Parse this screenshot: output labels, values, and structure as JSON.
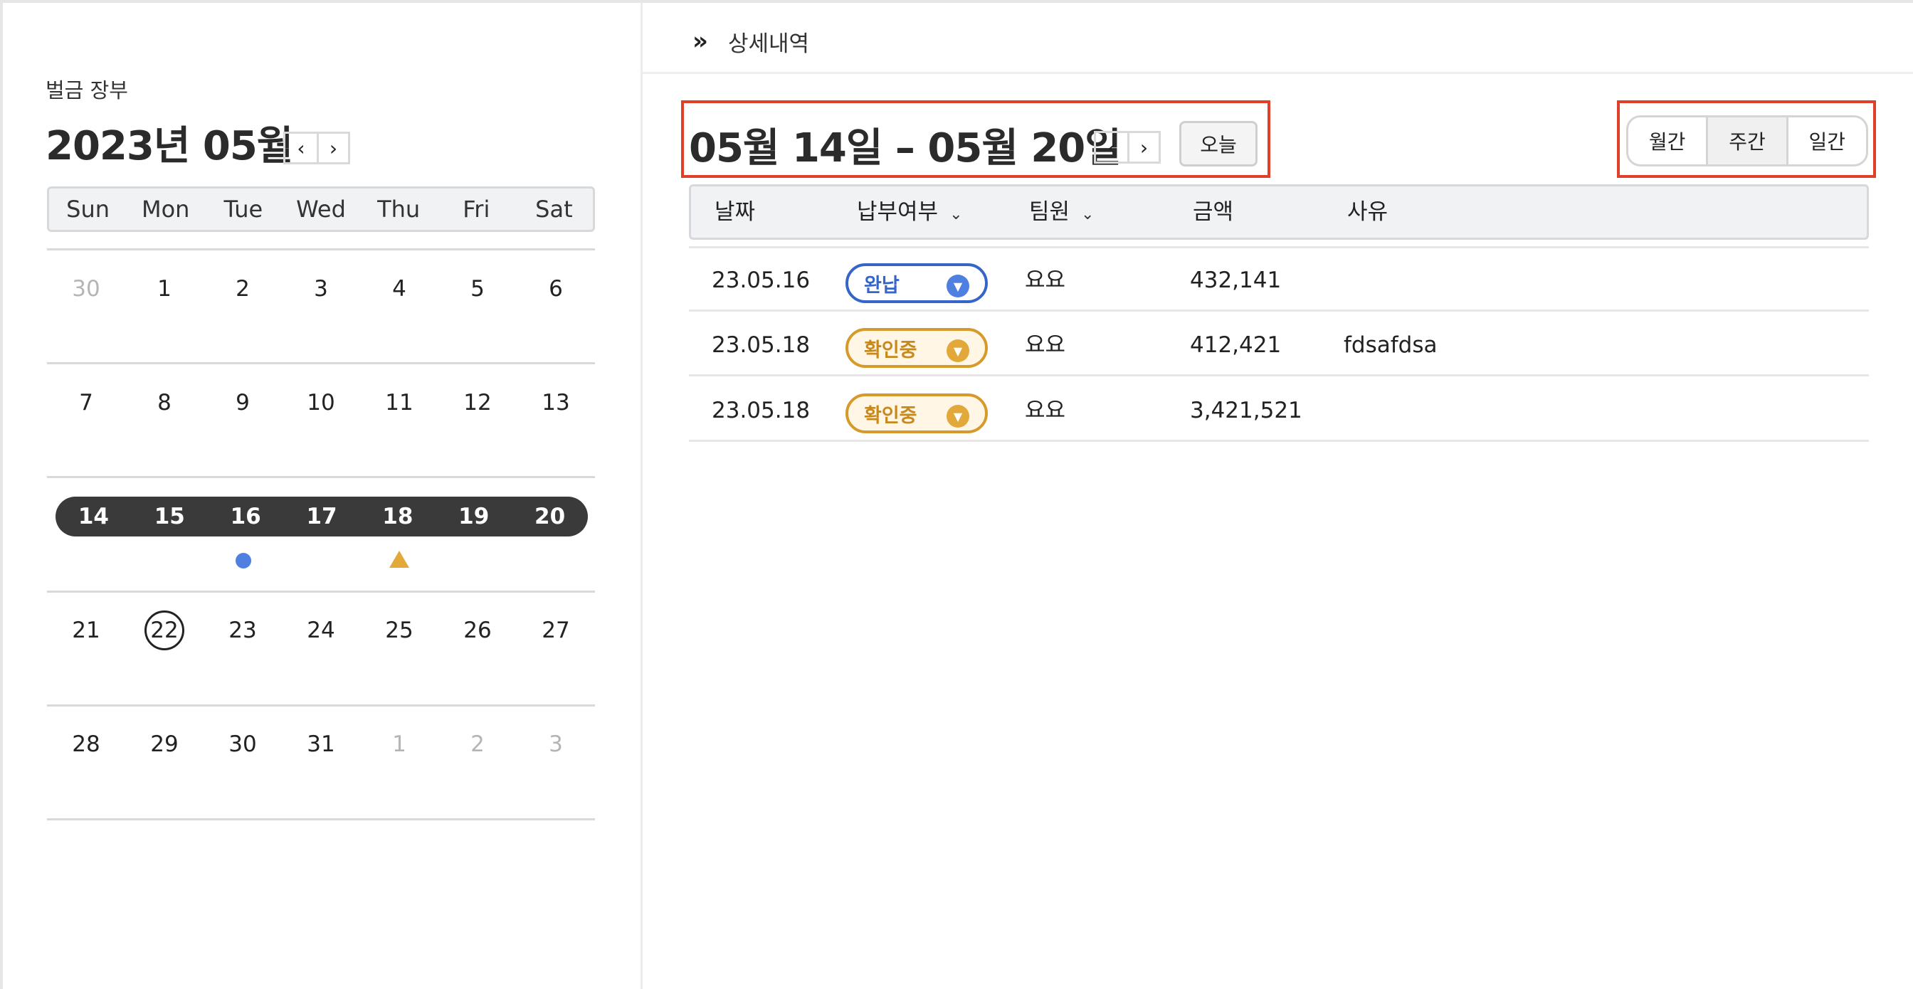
{
  "calendar": {
    "ledger_title": "벌금 장부",
    "month_title": "2023년 05월",
    "prev": "‹",
    "next": "›",
    "weekdays": [
      "Sun",
      "Mon",
      "Tue",
      "Wed",
      "Thu",
      "Fri",
      "Sat"
    ],
    "weeks": [
      [
        "30",
        "1",
        "2",
        "3",
        "4",
        "5",
        "6"
      ],
      [
        "7",
        "8",
        "9",
        "10",
        "11",
        "12",
        "13"
      ],
      [
        "14",
        "15",
        "16",
        "17",
        "18",
        "19",
        "20"
      ],
      [
        "21",
        "22",
        "23",
        "24",
        "25",
        "26",
        "27"
      ],
      [
        "28",
        "29",
        "30",
        "31",
        "1",
        "2",
        "3"
      ]
    ],
    "selected_week_index": 2,
    "today": "22",
    "marker_colors": {
      "paid": "#4f7fe0",
      "pending": "#e2a93a"
    }
  },
  "detail": {
    "header_icon": "double-chevron-right-icon",
    "header_label": "상세내역",
    "range_title": "05월 14일 – 05월 20일",
    "prev": "‹",
    "next": "›",
    "today_button": "오늘",
    "view_options": [
      "월간",
      "주간",
      "일간"
    ],
    "active_view": "주간",
    "columns": {
      "date": "날짜",
      "status": "납부여부",
      "member": "팀원",
      "amount": "금액",
      "reason": "사유"
    },
    "rows": [
      {
        "date": "23.05.16",
        "status": "완납",
        "status_type": "paid",
        "member": "요요",
        "amount": "432,141",
        "reason": ""
      },
      {
        "date": "23.05.18",
        "status": "확인중",
        "status_type": "pending",
        "member": "요요",
        "amount": "412,421",
        "reason": "fdsafdsa"
      },
      {
        "date": "23.05.18",
        "status": "확인중",
        "status_type": "pending",
        "member": "요요",
        "amount": "3,421,521",
        "reason": ""
      }
    ]
  },
  "colors": {
    "accent_red": "#e0402a",
    "paid_blue": "#3565c8",
    "pending_orange": "#d59a2a",
    "selected_week_bg": "#3a3a3a"
  }
}
